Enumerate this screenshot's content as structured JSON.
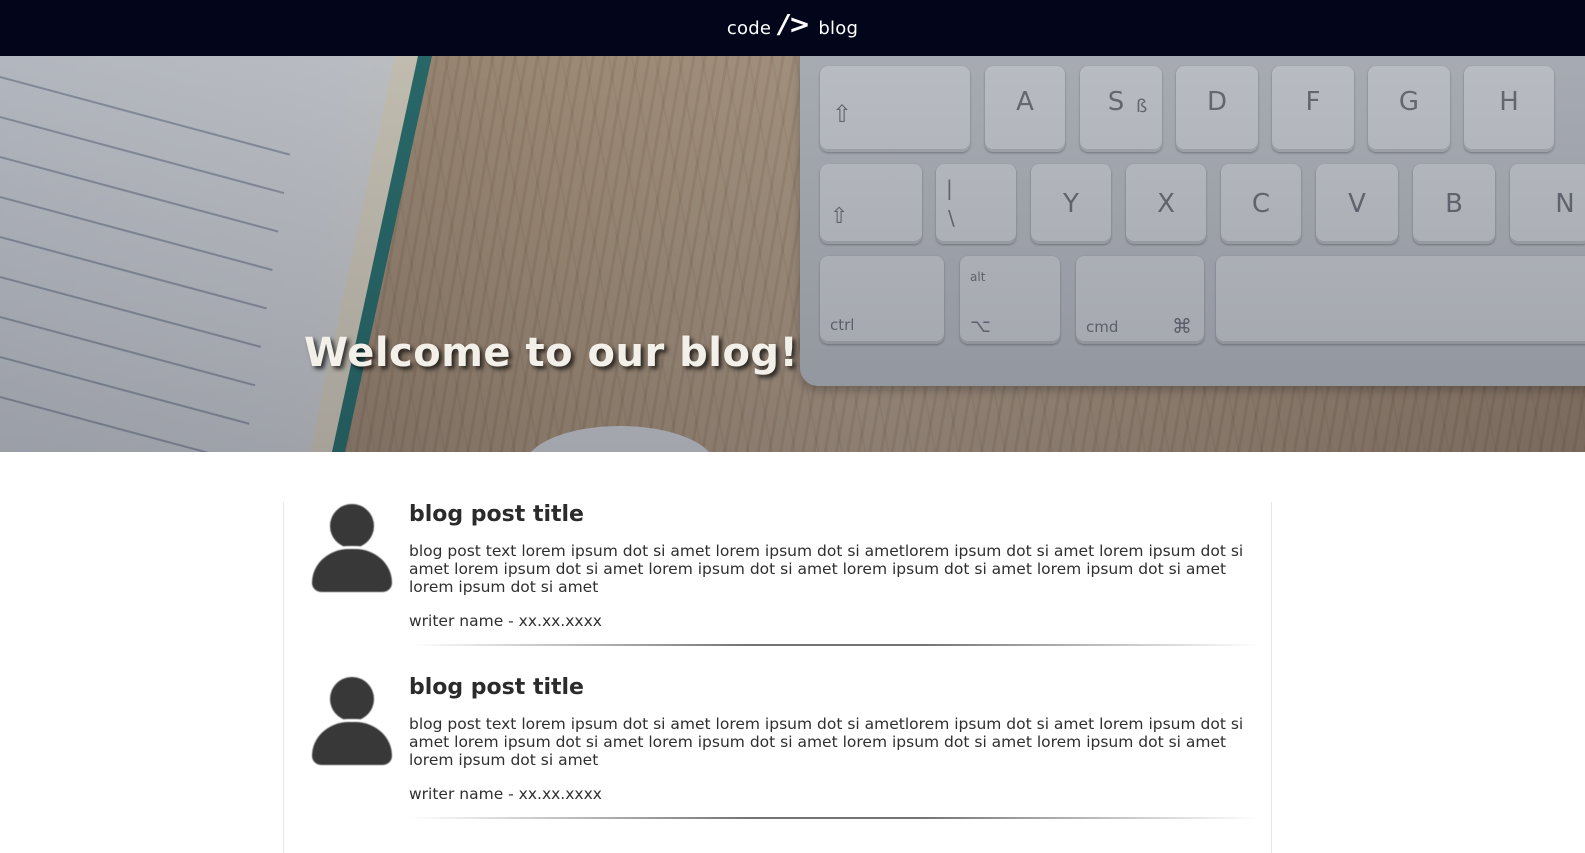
{
  "navbar": {
    "brand_left": "code",
    "brand_mark": "/>",
    "brand_right": "blog"
  },
  "hero": {
    "title": "Welcome to our blog!",
    "keys": {
      "row1": [
        "A",
        "S",
        "D",
        "F",
        "G",
        "H"
      ],
      "row1_sub": "ß",
      "row2": [
        "|",
        "Y",
        "X",
        "C",
        "V",
        "B",
        "N"
      ],
      "row2_sub": "\\",
      "ctrl": "ctrl",
      "alt": "alt",
      "option_symbol": "⌥",
      "cmd": "cmd",
      "cmd_symbol": "⌘",
      "shift_symbol": "⇧"
    }
  },
  "posts": [
    {
      "title": "blog post title",
      "text": "blog post text lorem ipsum dot si amet lorem ipsum dot si ametlorem ipsum dot si amet lorem ipsum dot si amet lorem ipsum dot si amet lorem ipsum dot si amet lorem ipsum dot si amet lorem ipsum dot si amet lorem ipsum dot si amet",
      "meta": "writer name - xx.xx.xxxx"
    },
    {
      "title": "blog post title",
      "text": "blog post text lorem ipsum dot si amet lorem ipsum dot si ametlorem ipsum dot si amet lorem ipsum dot si amet lorem ipsum dot si amet lorem ipsum dot si amet lorem ipsum dot si amet lorem ipsum dot si amet lorem ipsum dot si amet",
      "meta": "writer name - xx.xx.xxxx"
    }
  ],
  "colors": {
    "navbar_bg": "#03051a",
    "text": "#2b2b2b",
    "avatar": "#383838"
  }
}
